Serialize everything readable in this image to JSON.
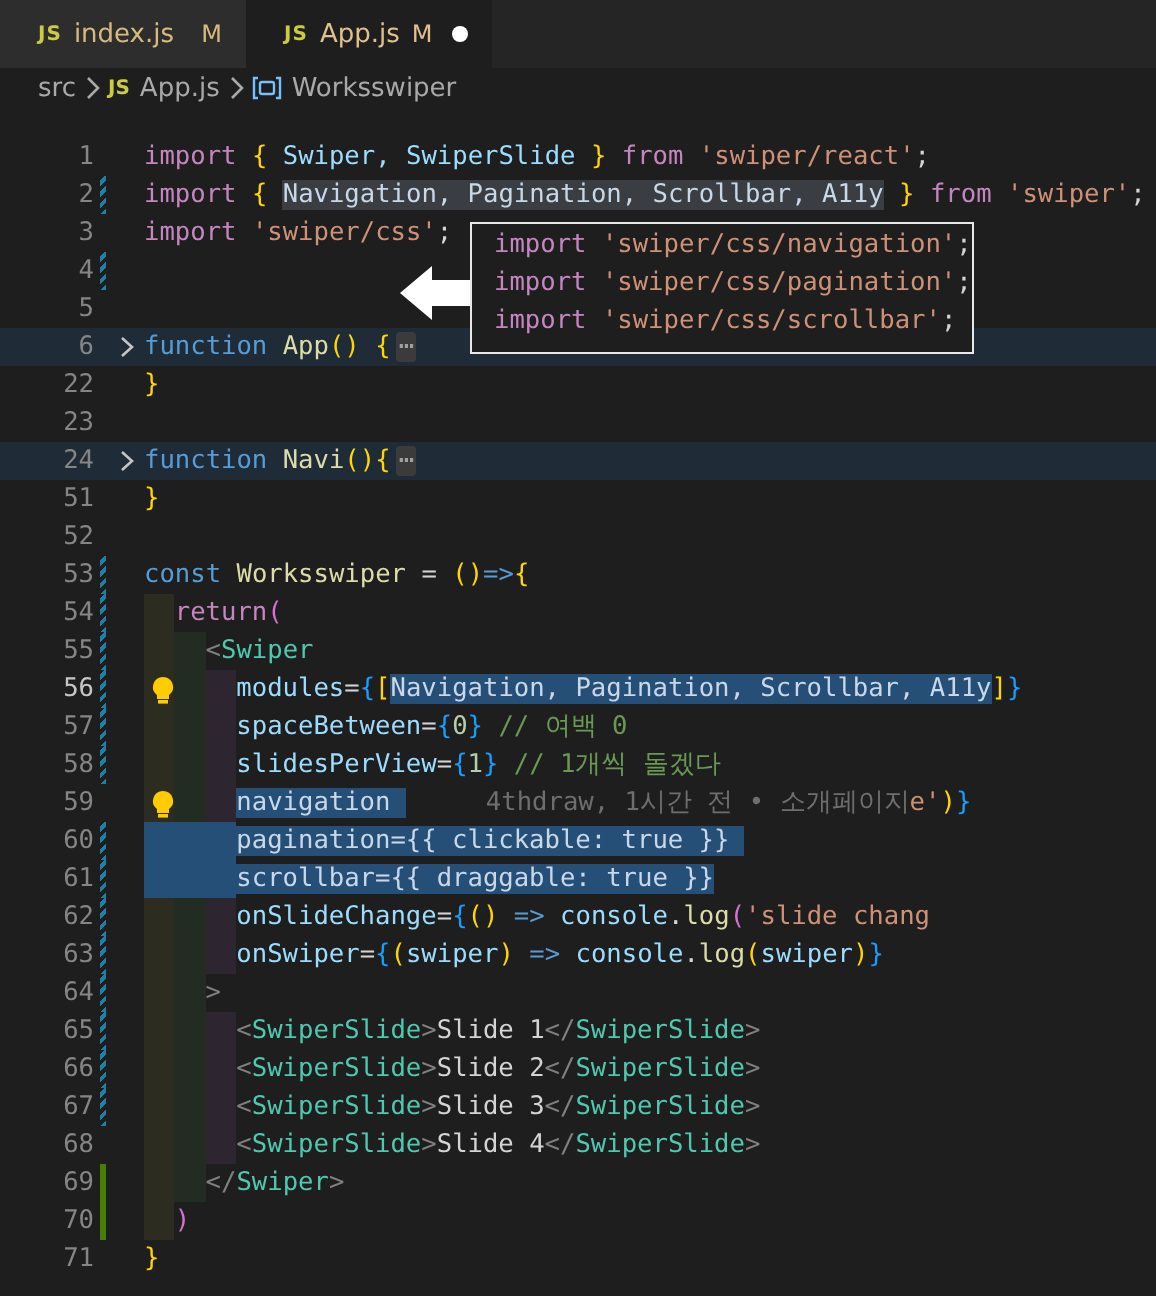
{
  "tabs": [
    {
      "icon": "JS",
      "label": "index.js",
      "status": "M",
      "dirty": false,
      "selected": false
    },
    {
      "icon": "JS",
      "label": "App.js",
      "status": "M",
      "dirty": true,
      "selected": true
    }
  ],
  "breadcrumb": [
    {
      "kind": "folder",
      "label": "src"
    },
    {
      "kind": "file",
      "icon": "JS",
      "label": "App.js"
    },
    {
      "kind": "symbol",
      "label": "Worksswiper"
    }
  ],
  "editor": {
    "lines": [
      {
        "number": "1",
        "tokens": [
          {
            "t": "import ",
            "color": "#c586c0"
          },
          {
            "t": "{",
            "color": "#ffd700"
          },
          {
            "t": " Swiper, SwiperSlide ",
            "color": "#9cdcfe"
          },
          {
            "t": "}",
            "color": "#ffd700"
          },
          {
            "t": " from ",
            "color": "#c586c0"
          },
          {
            "t": "'swiper/react'",
            "color": "#ce9178"
          },
          {
            "t": ";"
          }
        ]
      },
      {
        "number": "2",
        "modified": true,
        "tokens": [
          {
            "t": "import ",
            "color": "#c586c0"
          },
          {
            "t": "{ ",
            "color": "#ffd700"
          },
          {
            "t": "Navigation, Pagination, Scrollbar, A11y",
            "matched": true
          },
          {
            "t": " }",
            "color": "#ffd700"
          },
          {
            "t": " from ",
            "color": "#c586c0"
          },
          {
            "t": "'swiper'",
            "color": "#ce9178"
          },
          {
            "t": ";"
          }
        ]
      },
      {
        "number": "3",
        "tokens": [
          {
            "t": "import ",
            "color": "#c586c0"
          },
          {
            "t": "'swiper/css'",
            "color": "#ce9178"
          },
          {
            "t": ";"
          }
        ]
      },
      {
        "number": "4",
        "modified": true
      },
      {
        "number": "5"
      },
      {
        "number": "6",
        "folded": true,
        "fold_ellipsis": "⋯",
        "tokens": [
          {
            "t": "function ",
            "color": "#569cd6"
          },
          {
            "t": "App",
            "color": "#dcdcaa"
          },
          {
            "t": "()",
            "color": "#ffd700"
          },
          {
            "t": " {",
            "color": "#ffd700"
          }
        ]
      },
      {
        "number": "22",
        "tokens": [
          {
            "t": "}",
            "color": "#ffd700"
          }
        ]
      },
      {
        "number": "23"
      },
      {
        "number": "24",
        "folded": true,
        "fold_ellipsis": "⋯",
        "tokens": [
          {
            "t": "function ",
            "color": "#569cd6"
          },
          {
            "t": "Navi",
            "color": "#dcdcaa"
          },
          {
            "t": "()",
            "color": "#ffd700"
          },
          {
            "t": "{",
            "color": "#ffd700"
          }
        ]
      },
      {
        "number": "51",
        "tokens": [
          {
            "t": "}",
            "color": "#ffd700"
          }
        ]
      },
      {
        "number": "52"
      },
      {
        "number": "53",
        "modified": true,
        "tokens": [
          {
            "t": "const ",
            "color": "#569cd6"
          },
          {
            "t": "Worksswiper",
            "color": "#dcdcaa"
          },
          {
            "t": " = "
          },
          {
            "t": "()",
            "color": "#ffd700"
          },
          {
            "t": "=>",
            "color": "#569cd6"
          },
          {
            "t": "{",
            "color": "#ffd700"
          }
        ]
      },
      {
        "number": "54",
        "modified": true,
        "guides": [
          {
            "color": "#2c2c20"
          }
        ],
        "tokens": [
          {
            "t": "return",
            "color": "#c586c0"
          },
          {
            "t": "(",
            "color": "#da70d6"
          }
        ]
      },
      {
        "number": "55",
        "modified": true,
        "guides": [
          {
            "color": "#2c2c20"
          },
          {
            "color": "#232c23"
          }
        ],
        "tokens": [
          {
            "t": "<",
            "color": "#808080"
          },
          {
            "t": "Swiper",
            "color": "#4ec9b0"
          }
        ]
      },
      {
        "number": "56",
        "modified": true,
        "bulb": true,
        "current": true,
        "guides": [
          {
            "color": "#2c2c20"
          },
          {
            "color": "#232c23"
          },
          {
            "color": "#2d2530"
          }
        ],
        "tokens": [
          {
            "t": "modules",
            "color": "#9cdcfe"
          },
          {
            "t": "="
          },
          {
            "t": "{",
            "color": "#179fff"
          },
          {
            "t": "[",
            "color": "#ffd700"
          },
          {
            "t": "Navigation, Pagination, Scrollbar, A11y",
            "selected": true
          },
          {
            "t": "]",
            "color": "#ffd700"
          },
          {
            "t": "}",
            "color": "#179fff"
          }
        ]
      },
      {
        "number": "57",
        "modified": true,
        "guides": [
          {
            "color": "#2c2c20"
          },
          {
            "color": "#232c23"
          },
          {
            "color": "#2d2530"
          }
        ],
        "tokens": [
          {
            "t": "spaceBetween",
            "color": "#9cdcfe"
          },
          {
            "t": "="
          },
          {
            "t": "{",
            "color": "#179fff"
          },
          {
            "t": "0",
            "color": "#b5cea8"
          },
          {
            "t": "}",
            "color": "#179fff"
          },
          {
            "t": " // 여백 0",
            "color": "#6a9955"
          }
        ]
      },
      {
        "number": "58",
        "modified": true,
        "guides": [
          {
            "color": "#2c2c20"
          },
          {
            "color": "#232c23"
          },
          {
            "color": "#2d2530"
          }
        ],
        "tokens": [
          {
            "t": "slidesPerView",
            "color": "#9cdcfe"
          },
          {
            "t": "="
          },
          {
            "t": "{",
            "color": "#179fff"
          },
          {
            "t": "1",
            "color": "#b5cea8"
          },
          {
            "t": "}",
            "color": "#179fff"
          },
          {
            "t": " // 1개씩 돌겠다",
            "color": "#6a9955"
          }
        ]
      },
      {
        "number": "59",
        "bulb": true,
        "guides": [
          {
            "color": "#2c2c20"
          },
          {
            "color": "#232c23"
          },
          {
            "color": "#2d2530"
          }
        ],
        "tokens": [
          {
            "t": "navigation ",
            "selected": true
          }
        ],
        "annotation": "4thdraw, 1시간 전 • 소개페이지",
        "tokens_after": [
          {
            "t": "e'",
            "color": "#ce9178"
          },
          {
            "t": ")",
            "color": "#ffd700"
          },
          {
            "t": "}",
            "color": "#179fff"
          }
        ]
      },
      {
        "number": "60",
        "modified": true,
        "guides": [
          {
            "color": "#264f78"
          },
          {
            "color": "#264f78"
          },
          {
            "color": "#264f78"
          }
        ],
        "tokens": [
          {
            "t": "pagination={{ clickable: true }} ",
            "selected": true
          }
        ]
      },
      {
        "number": "61",
        "modified": true,
        "guides": [
          {
            "color": "#264f78"
          },
          {
            "color": "#264f78"
          },
          {
            "color": "#264f78"
          }
        ],
        "tokens": [
          {
            "t": "scrollbar={{ draggable: true }}",
            "selected": true
          }
        ]
      },
      {
        "number": "62",
        "modified": true,
        "guides": [
          {
            "color": "#2c2c20"
          },
          {
            "color": "#232c23"
          },
          {
            "color": "#2d2530"
          }
        ],
        "tokens": [
          {
            "t": "onSlideChange",
            "color": "#9cdcfe"
          },
          {
            "t": "="
          },
          {
            "t": "{",
            "color": "#179fff"
          },
          {
            "t": "() ",
            "color": "#ffd700"
          },
          {
            "t": "=> ",
            "color": "#569cd6"
          },
          {
            "t": "console",
            "color": "#9cdcfe"
          },
          {
            "t": "."
          },
          {
            "t": "log",
            "color": "#dcdcaa"
          },
          {
            "t": "(",
            "color": "#da70d6"
          },
          {
            "t": "'slide chang",
            "color": "#ce9178"
          }
        ]
      },
      {
        "number": "63",
        "modified": true,
        "guides": [
          {
            "color": "#2c2c20"
          },
          {
            "color": "#232c23"
          },
          {
            "color": "#2d2530"
          }
        ],
        "tokens": [
          {
            "t": "onSwiper",
            "color": "#9cdcfe"
          },
          {
            "t": "="
          },
          {
            "t": "{",
            "color": "#179fff"
          },
          {
            "t": "(",
            "color": "#ffd700"
          },
          {
            "t": "swiper",
            "color": "#9cdcfe"
          },
          {
            "t": ") ",
            "color": "#ffd700"
          },
          {
            "t": "=> ",
            "color": "#569cd6"
          },
          {
            "t": "console",
            "color": "#9cdcfe"
          },
          {
            "t": "."
          },
          {
            "t": "log",
            "color": "#dcdcaa"
          },
          {
            "t": "(",
            "color": "#ffd700"
          },
          {
            "t": "swiper",
            "color": "#9cdcfe"
          },
          {
            "t": ")",
            "color": "#ffd700"
          },
          {
            "t": "}",
            "color": "#179fff"
          }
        ]
      },
      {
        "number": "64",
        "modified": true,
        "guides": [
          {
            "color": "#2c2c20"
          },
          {
            "color": "#232c23"
          }
        ],
        "tokens": [
          {
            "t": ">",
            "color": "#808080"
          }
        ]
      },
      {
        "number": "65",
        "modified": true,
        "guides": [
          {
            "color": "#2c2c20"
          },
          {
            "color": "#232c23"
          },
          {
            "color": "#2d2530"
          }
        ],
        "tokens": [
          {
            "t": "<",
            "color": "#808080"
          },
          {
            "t": "SwiperSlide",
            "color": "#4ec9b0"
          },
          {
            "t": ">",
            "color": "#808080"
          },
          {
            "t": "Slide 1"
          },
          {
            "t": "</",
            "color": "#808080"
          },
          {
            "t": "SwiperSlide",
            "color": "#4ec9b0"
          },
          {
            "t": ">",
            "color": "#808080"
          }
        ]
      },
      {
        "number": "66",
        "modified": true,
        "guides": [
          {
            "color": "#2c2c20"
          },
          {
            "color": "#232c23"
          },
          {
            "color": "#2d2530"
          }
        ],
        "tokens": [
          {
            "t": "<",
            "color": "#808080"
          },
          {
            "t": "SwiperSlide",
            "color": "#4ec9b0"
          },
          {
            "t": ">",
            "color": "#808080"
          },
          {
            "t": "Slide 2"
          },
          {
            "t": "</",
            "color": "#808080"
          },
          {
            "t": "SwiperSlide",
            "color": "#4ec9b0"
          },
          {
            "t": ">",
            "color": "#808080"
          }
        ]
      },
      {
        "number": "67",
        "modified": true,
        "guides": [
          {
            "color": "#2c2c20"
          },
          {
            "color": "#232c23"
          },
          {
            "color": "#2d2530"
          }
        ],
        "tokens": [
          {
            "t": "<",
            "color": "#808080"
          },
          {
            "t": "SwiperSlide",
            "color": "#4ec9b0"
          },
          {
            "t": ">",
            "color": "#808080"
          },
          {
            "t": "Slide 3"
          },
          {
            "t": "</",
            "color": "#808080"
          },
          {
            "t": "SwiperSlide",
            "color": "#4ec9b0"
          },
          {
            "t": ">",
            "color": "#808080"
          }
        ]
      },
      {
        "number": "68",
        "guides": [
          {
            "color": "#2c2c20"
          },
          {
            "color": "#232c23"
          },
          {
            "color": "#2d2530"
          }
        ],
        "tokens": [
          {
            "t": "<",
            "color": "#808080"
          },
          {
            "t": "SwiperSlide",
            "color": "#4ec9b0"
          },
          {
            "t": ">",
            "color": "#808080"
          },
          {
            "t": "Slide 4"
          },
          {
            "t": "</",
            "color": "#808080"
          },
          {
            "t": "SwiperSlide",
            "color": "#4ec9b0"
          },
          {
            "t": ">",
            "color": "#808080"
          }
        ]
      },
      {
        "number": "69",
        "added": true,
        "guides": [
          {
            "color": "#2c2c20"
          },
          {
            "color": "#232c23"
          }
        ],
        "tokens": [
          {
            "t": "</",
            "color": "#808080"
          },
          {
            "t": "Swiper",
            "color": "#4ec9b0"
          },
          {
            "t": ">",
            "color": "#808080"
          }
        ]
      },
      {
        "number": "70",
        "added": true,
        "guides": [
          {
            "color": "#2c2c20"
          }
        ],
        "tokens": [
          {
            "t": ")",
            "color": "#da70d6"
          }
        ]
      },
      {
        "number": "71",
        "tokens": [
          {
            "t": "}",
            "color": "#ffd700"
          }
        ]
      }
    ]
  },
  "popup": {
    "lines": [
      {
        "tokens": [
          {
            "t": "import ",
            "color": "#c586c0"
          },
          {
            "t": "'swiper/css/navigation'",
            "color": "#ce9178"
          },
          {
            "t": ";"
          }
        ]
      },
      {
        "tokens": [
          {
            "t": "import ",
            "color": "#c586c0"
          },
          {
            "t": "'swiper/css/pagination'",
            "color": "#ce9178"
          },
          {
            "t": ";"
          }
        ]
      },
      {
        "tokens": [
          {
            "t": "import ",
            "color": "#c586c0"
          },
          {
            "t": "'swiper/css/scrollbar'",
            "color": "#ce9178"
          },
          {
            "t": ";"
          }
        ]
      }
    ]
  }
}
